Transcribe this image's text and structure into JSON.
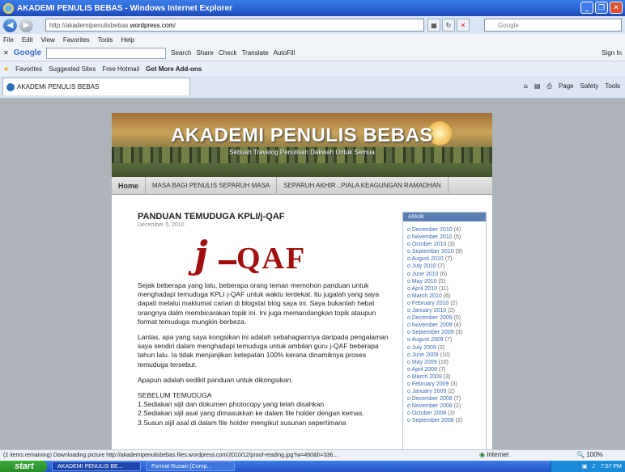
{
  "window": {
    "title": "AKADEMI PENULIS BEBAS - Windows Internet Explorer",
    "min": "_",
    "max": "❐",
    "close": "✕"
  },
  "address": {
    "url_prefix": "http://akademipenulisbebas.",
    "url_host": "wordpress.com",
    "url_suffix": "/",
    "search_placeholder": "Google"
  },
  "menu": [
    "File",
    "Edit",
    "View",
    "Favorites",
    "Tools",
    "Help"
  ],
  "google_toolbar": {
    "brand": "Google",
    "items": [
      "Search",
      "Share",
      "Check",
      "Translate",
      "AutoFill"
    ],
    "signin": "Sign In"
  },
  "favorites_bar": {
    "favorites": "Favorites",
    "items": [
      "Suggested Sites",
      "Free Hotmail",
      "Get More Add-ons"
    ]
  },
  "tab": {
    "title": "AKADEMI PENULIS BEBAS"
  },
  "command_bar": [
    "Page",
    "Safety",
    "Tools"
  ],
  "site": {
    "title": "AKADEMI PENULIS BEBAS",
    "tagline": "Sebuah Travelog Penulisan Dakwah Untuk Semua",
    "nav": [
      "Home",
      "MASA BAGI PENULIS SEPARUH MASA",
      "SEPARUH AKHIR ..PIALA KEAGUNGAN RAMADHAN"
    ]
  },
  "post": {
    "title": "PANDUAN TEMUDUGA KPLI/j-QAF",
    "date": "December 5, 2010",
    "logo_j": "j",
    "logo_qaf": "QAF",
    "p1": "Sejak beberapa yang lalu, beberapa orang teman memohon panduan untuk menghadapi temuduga KPLI j-QAF untuk waktu terdekat. Itu jugalah yang saya dapati melalui maklumat carian di blogstat blog saya ini. Saya bukanlah hebat orangnya dalm membicarakan topik ini. Ini juga memandangkan topik ataupun format temuduga mungkin berbeza.",
    "p2": "Lantas, apa yang saya kongsikan ini adalah sebahagiannya daripada pengalaman saya sendiri dalam menghadapi temuduga untuk ambilan guru j-QAF beberapa tahun lalu. Ia tidak menjanjikan ketepatan 100% kerana dinamiknya proses temuduga tersebut.",
    "p3": "Apapun adalah sedikit panduan untuk dikongsikan.",
    "list_title": "SEBELUM TEMUDUGA",
    "list1": "1.Sediakan sijil dan dokumen photocopy yang telah disahkan",
    "list2": "2.Sediakan sijil asal yang dimasukkan ke dalam file holder dengan kemas.",
    "list3": "3.Susun sijil asal di dalam file holder mengikut susunan sepertimana"
  },
  "archive": {
    "heading": "ARKIB",
    "items": [
      {
        "label": "December 2010",
        "count": "(4)"
      },
      {
        "label": "November 2010",
        "count": "(5)"
      },
      {
        "label": "October 2010",
        "count": "(3)"
      },
      {
        "label": "September 2010",
        "count": "(9)"
      },
      {
        "label": "August 2010",
        "count": "(7)"
      },
      {
        "label": "July 2010",
        "count": "(7)"
      },
      {
        "label": "June 2010",
        "count": "(6)"
      },
      {
        "label": "May 2010",
        "count": "(5)"
      },
      {
        "label": "April 2010",
        "count": "(11)"
      },
      {
        "label": "March 2010",
        "count": "(6)"
      },
      {
        "label": "February 2010",
        "count": "(2)"
      },
      {
        "label": "January 2010",
        "count": "(2)"
      },
      {
        "label": "December 2009",
        "count": "(5)"
      },
      {
        "label": "November 2009",
        "count": "(4)"
      },
      {
        "label": "September 2009",
        "count": "(3)"
      },
      {
        "label": "August 2009",
        "count": "(7)"
      },
      {
        "label": "July 2009",
        "count": "(2)"
      },
      {
        "label": "June 2009",
        "count": "(10)"
      },
      {
        "label": "May 2009",
        "count": "(10)"
      },
      {
        "label": "April 2009",
        "count": "(7)"
      },
      {
        "label": "March 2009",
        "count": "(3)"
      },
      {
        "label": "February 2009",
        "count": "(3)"
      },
      {
        "label": "January 2009",
        "count": "(2)"
      },
      {
        "label": "December 2008",
        "count": "(7)"
      },
      {
        "label": "November 2008",
        "count": "(2)"
      },
      {
        "label": "October 2008",
        "count": "(3)"
      },
      {
        "label": "September 2008",
        "count": "(2)"
      }
    ]
  },
  "status": {
    "text": "(2 items remaining) Downloading picture http://akademipenulisbebas.files.wordpress.com/2010/12/proof-reading.jpg?w=450&h=336...",
    "zone": "Internet",
    "zoom": "100%"
  },
  "taskbar": {
    "start": "start",
    "tasks": [
      "AKADEMI PENULIS BE...",
      "Format Ruzain [Comp..."
    ],
    "clock": "7:57 PM"
  }
}
